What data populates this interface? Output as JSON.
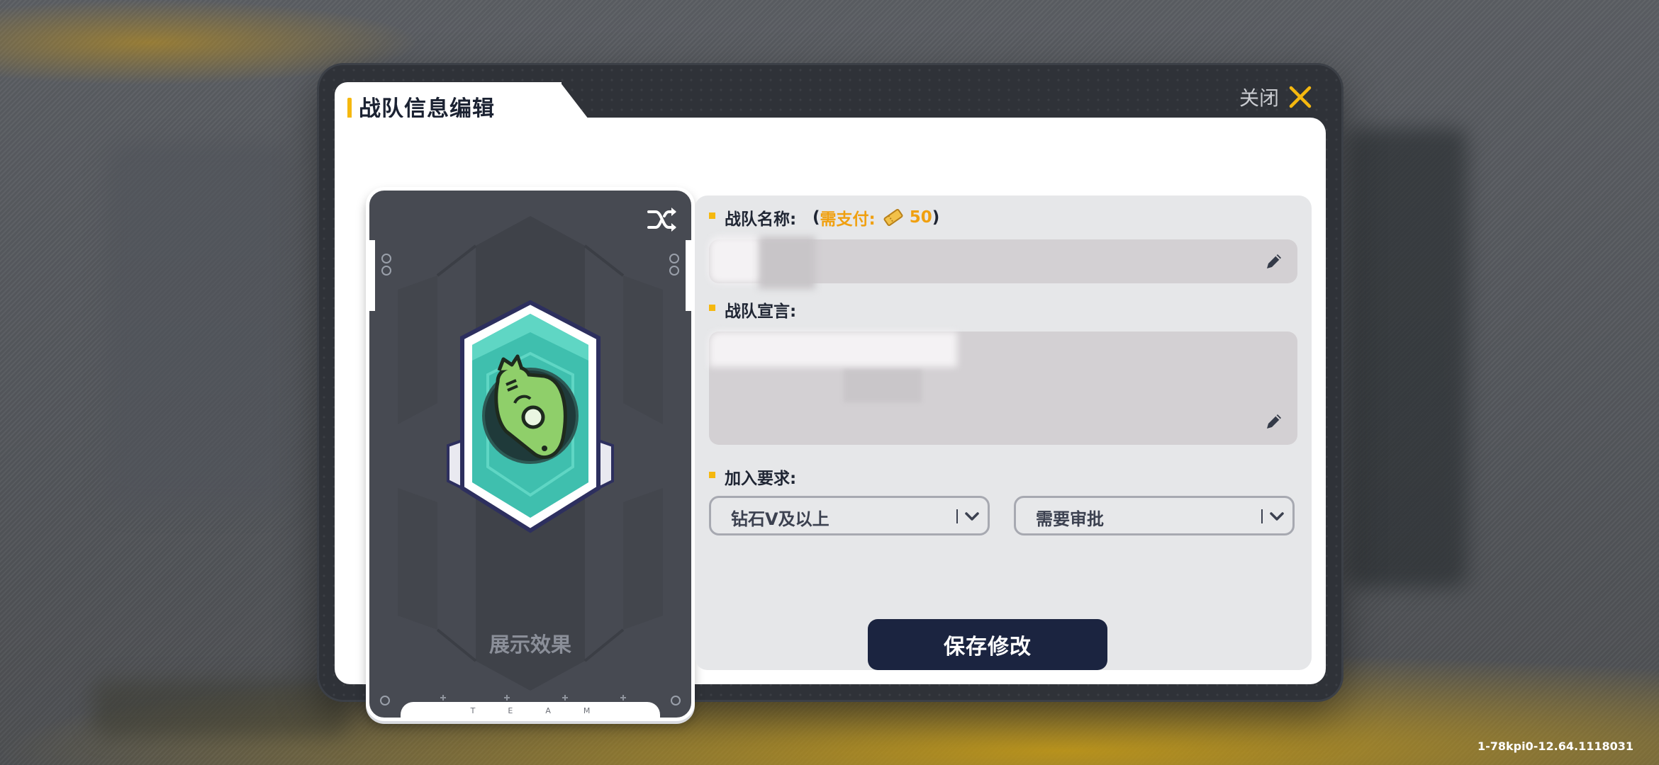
{
  "dialog": {
    "title": "战队信息编辑",
    "close_label": "关闭"
  },
  "preview": {
    "label": "展示效果",
    "team_text": "TEAM"
  },
  "form": {
    "name_label": "战队名称:",
    "cost_open": "(",
    "cost_label": "需支付:",
    "cost_amount": "50",
    "cost_close": ")",
    "name_value": "",
    "declaration_label": "战队宣言:",
    "declaration_value": "",
    "join_label": "加入要求:",
    "rank_requirement": "钻石V及以上",
    "approval_requirement": "需要审批"
  },
  "actions": {
    "save_label": "保存修改"
  },
  "footer": {
    "version": "1-78kpi0-12.64.1118031"
  },
  "colors": {
    "accent": "#f5b80f",
    "cost": "#f0a010",
    "button": "#1b2440",
    "emblem_teal": "#3fbfae",
    "emblem_green": "#8fcf6a"
  },
  "icons": [
    "close-icon",
    "shuffle-icon",
    "ticket-icon",
    "edit-icon",
    "chevron-down-icon",
    "team-emblem"
  ]
}
